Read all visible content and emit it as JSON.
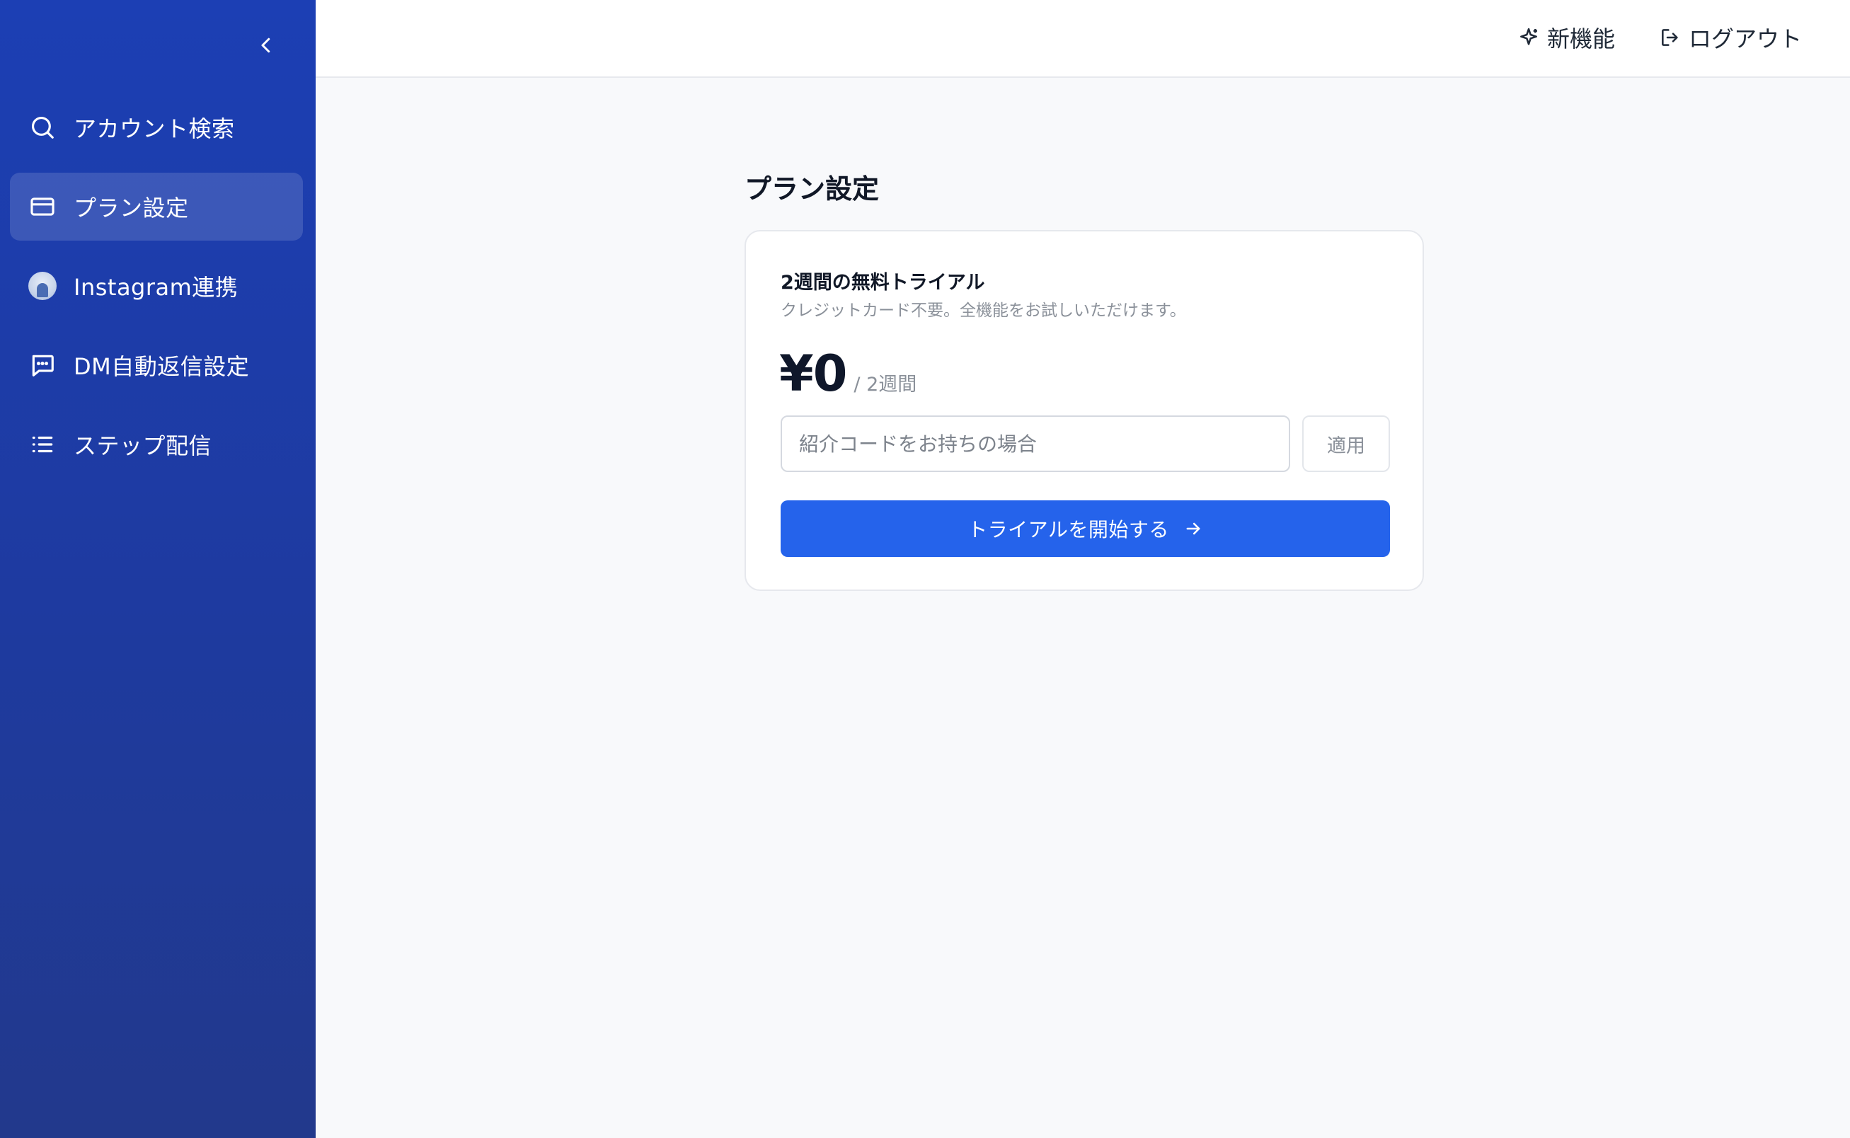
{
  "sidebar": {
    "collapse_icon": "chevron-left-icon",
    "items": [
      {
        "label": "アカウント検索",
        "icon": "search-icon",
        "active": false
      },
      {
        "label": "プラン設定",
        "icon": "credit-card-icon",
        "active": true
      },
      {
        "label": "Instagram連携",
        "icon": "avatar-icon",
        "active": false
      },
      {
        "label": "DM自動返信設定",
        "icon": "message-icon",
        "active": false
      },
      {
        "label": "ステップ配信",
        "icon": "list-icon",
        "active": false
      }
    ]
  },
  "header": {
    "new_features_label": "新機能",
    "new_features_icon": "sparkle-icon",
    "logout_label": "ログアウト",
    "logout_icon": "logout-icon"
  },
  "main": {
    "page_title": "プラン設定",
    "plan_card": {
      "title": "2週間の無料トライアル",
      "subtitle": "クレジットカード不要。全機能をお試しいただけます。",
      "price": "¥0",
      "period": "/ 2週間",
      "referral_input": {
        "value": "",
        "placeholder": "紹介コードをお持ちの場合"
      },
      "apply_label": "適用",
      "start_label": "トライアルを開始する",
      "start_icon": "arrow-right-icon"
    }
  },
  "colors": {
    "sidebar_top": "#1c3fb4",
    "sidebar_bottom": "#22398c",
    "primary_button": "#2563eb",
    "page_background": "#f8f9fb"
  }
}
